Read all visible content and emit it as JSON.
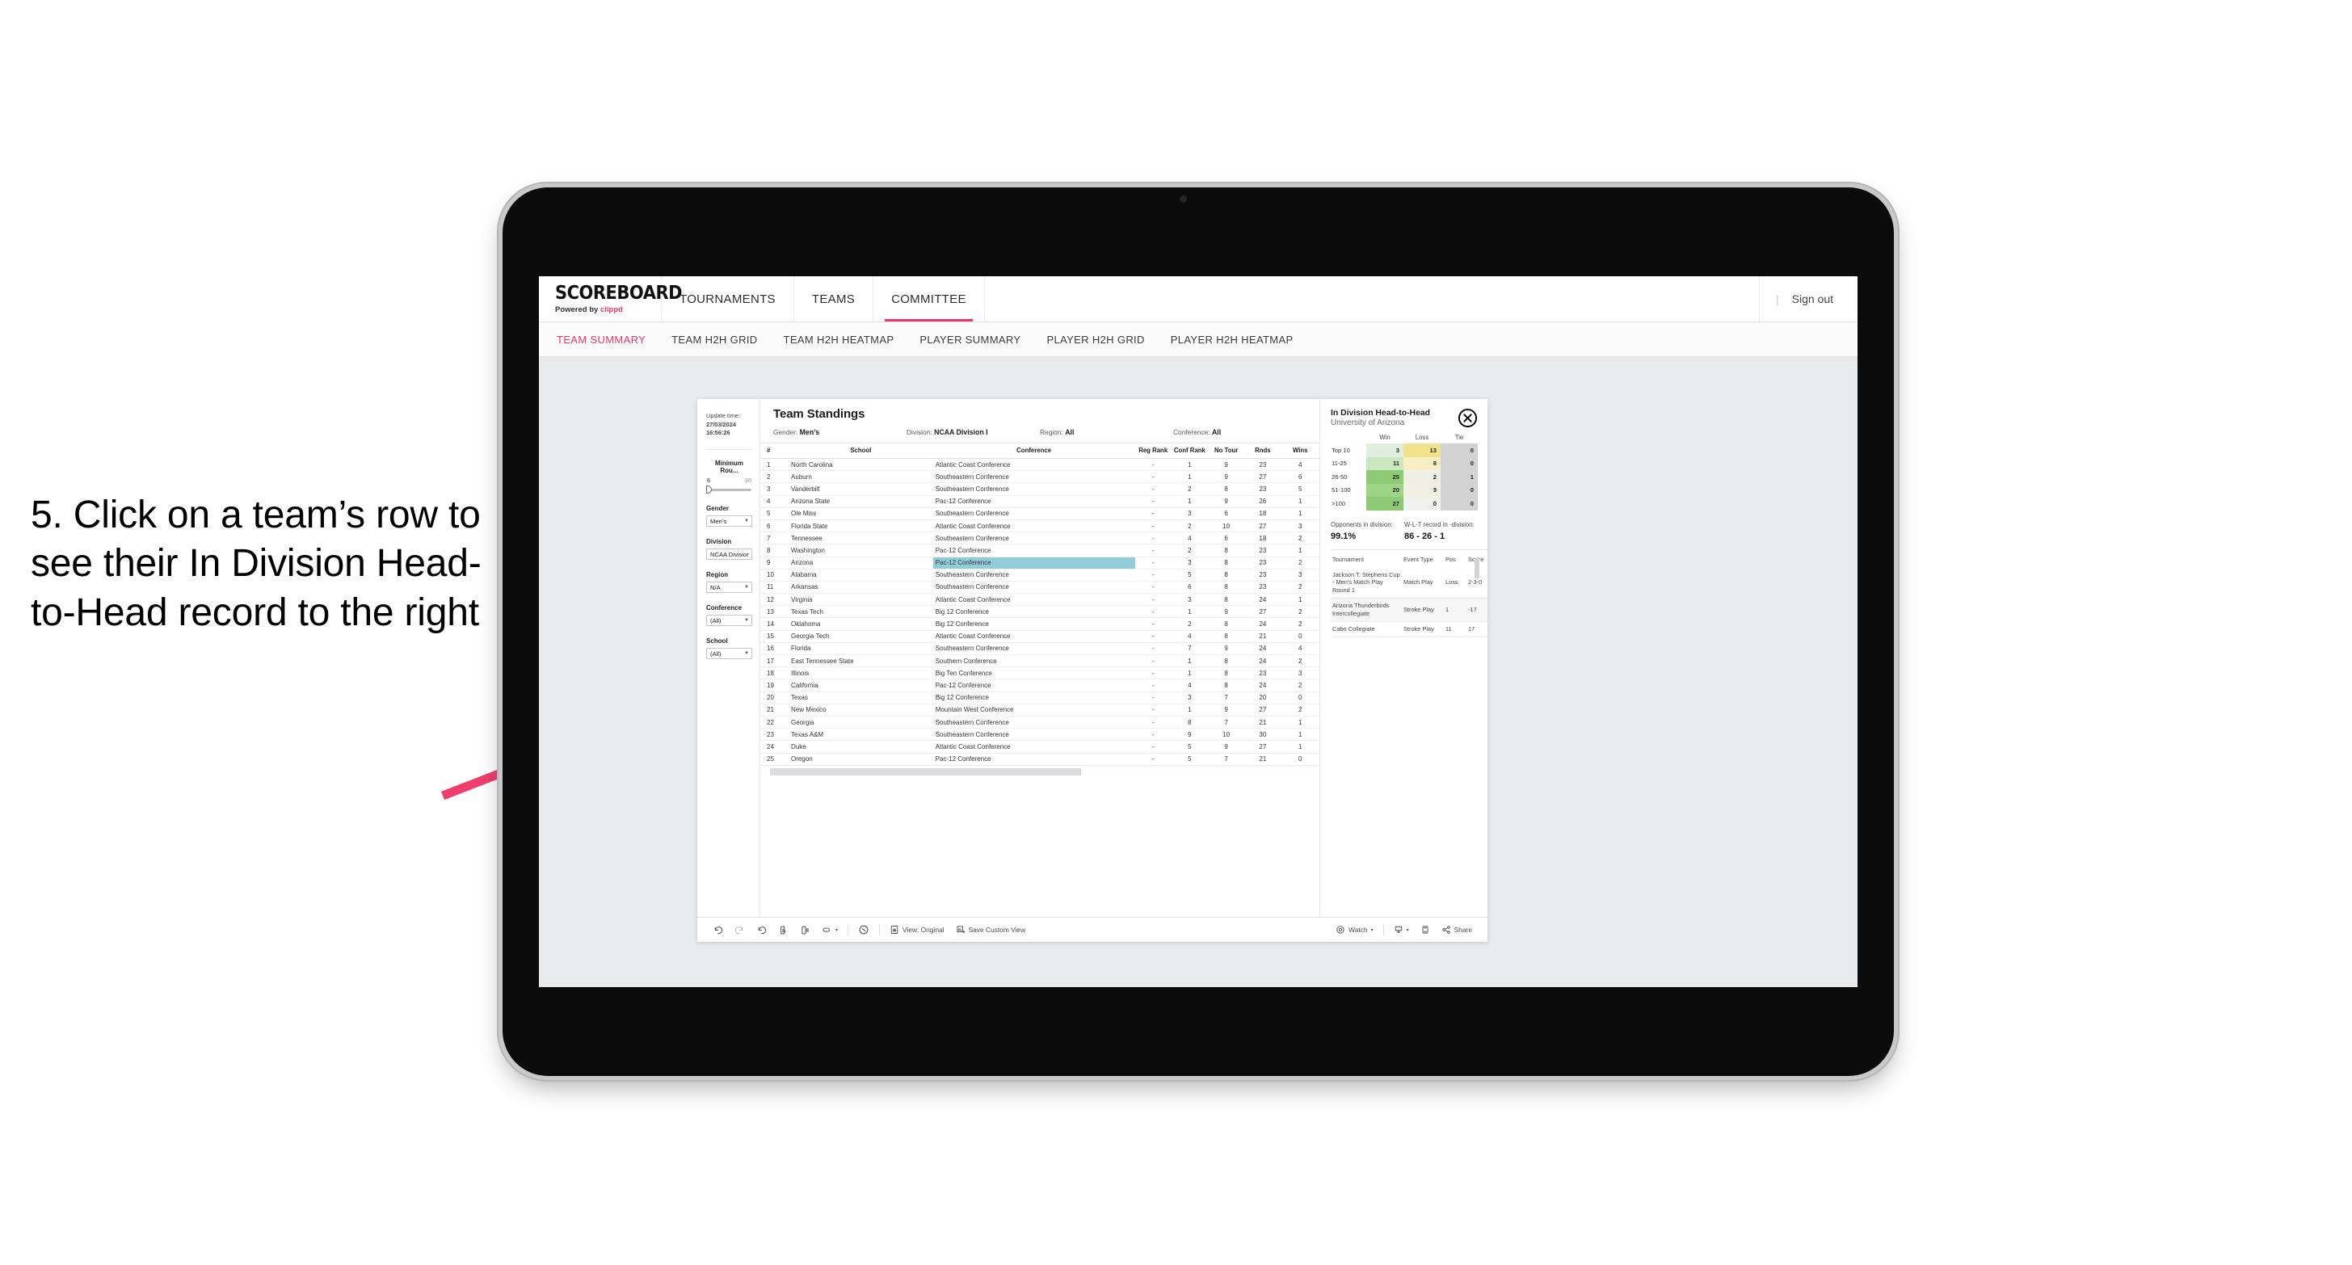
{
  "caption": "5. Click on a team’s row to see their In Division Head-to-Head record to the right",
  "colors": {
    "accent": "#e8386a",
    "highlight": "#92ccd9",
    "win": "#84c96b",
    "loss": "#f0dd8a",
    "tie": "#d0d0d0"
  },
  "topnav": {
    "logo": "SCOREBOARD",
    "powered_prefix": "Powered by ",
    "powered_brand": "clippd",
    "items": [
      {
        "label": "TOURNAMENTS",
        "active": false
      },
      {
        "label": "TEAMS",
        "active": false
      },
      {
        "label": "COMMITTEE",
        "active": true
      }
    ],
    "divider": "|",
    "sign_out": "Sign out"
  },
  "subtabs": [
    {
      "label": "TEAM SUMMARY",
      "active": true
    },
    {
      "label": "TEAM H2H GRID",
      "active": false
    },
    {
      "label": "TEAM H2H HEATMAP",
      "active": false
    },
    {
      "label": "PLAYER SUMMARY",
      "active": false
    },
    {
      "label": "PLAYER H2H GRID",
      "active": false
    },
    {
      "label": "PLAYER H2H HEATMAP",
      "active": false
    }
  ],
  "filters": {
    "update_time_label": "Update time:",
    "update_time_value": "27/03/2024 16:56:26",
    "min_rounds": {
      "label": "Minimum Rou...",
      "min": "6",
      "max": "30"
    },
    "groups": [
      {
        "label": "Gender",
        "value": "Men’s"
      },
      {
        "label": "Division",
        "value": "NCAA Division I"
      },
      {
        "label": "Region",
        "value": "N/A"
      },
      {
        "label": "Conference",
        "value": "(All)"
      },
      {
        "label": "School",
        "value": "(All)"
      }
    ]
  },
  "sheet": {
    "title": "Team Standings",
    "crumbs": [
      {
        "key": "Gender:",
        "value": "Men’s"
      },
      {
        "key": "Division:",
        "value": "NCAA Division I"
      },
      {
        "key": "Region:",
        "value": "All"
      },
      {
        "key": "Conference:",
        "value": "All"
      }
    ],
    "columns": [
      "#",
      "School",
      "Conference",
      "Reg Rank",
      "Conf Rank",
      "No Tour",
      "Rnds",
      "Wins"
    ],
    "highlight_row_index": 8,
    "rows": [
      [
        "1",
        "North Carolina",
        "Atlantic Coast Conference",
        "-",
        "1",
        "9",
        "23",
        "4"
      ],
      [
        "2",
        "Auburn",
        "Southeastern Conference",
        "-",
        "1",
        "9",
        "27",
        "6"
      ],
      [
        "3",
        "Vanderbilt",
        "Southeastern Conference",
        "-",
        "2",
        "8",
        "23",
        "5"
      ],
      [
        "4",
        "Arizona State",
        "Pac-12 Conference",
        "-",
        "1",
        "9",
        "26",
        "1"
      ],
      [
        "5",
        "Ole Miss",
        "Southeastern Conference",
        "-",
        "3",
        "6",
        "18",
        "1"
      ],
      [
        "6",
        "Florida State",
        "Atlantic Coast Conference",
        "-",
        "2",
        "10",
        "27",
        "3"
      ],
      [
        "7",
        "Tennessee",
        "Southeastern Conference",
        "-",
        "4",
        "6",
        "18",
        "2"
      ],
      [
        "8",
        "Washington",
        "Pac-12 Conference",
        "-",
        "2",
        "8",
        "23",
        "1"
      ],
      [
        "9",
        "Arizona",
        "Pac-12 Conference",
        "-",
        "3",
        "8",
        "23",
        "2"
      ],
      [
        "10",
        "Alabama",
        "Southeastern Conference",
        "-",
        "5",
        "8",
        "23",
        "3"
      ],
      [
        "11",
        "Arkansas",
        "Southeastern Conference",
        "-",
        "6",
        "8",
        "23",
        "2"
      ],
      [
        "12",
        "Virginia",
        "Atlantic Coast Conference",
        "-",
        "3",
        "8",
        "24",
        "1"
      ],
      [
        "13",
        "Texas Tech",
        "Big 12 Conference",
        "-",
        "1",
        "9",
        "27",
        "2"
      ],
      [
        "14",
        "Oklahoma",
        "Big 12 Conference",
        "-",
        "2",
        "8",
        "24",
        "2"
      ],
      [
        "15",
        "Georgia Tech",
        "Atlantic Coast Conference",
        "-",
        "4",
        "8",
        "21",
        "0"
      ],
      [
        "16",
        "Florida",
        "Southeastern Conference",
        "-",
        "7",
        "9",
        "24",
        "4"
      ],
      [
        "17",
        "East Tennessee State",
        "Southern Conference",
        "-",
        "1",
        "8",
        "24",
        "2"
      ],
      [
        "18",
        "Illinois",
        "Big Ten Conference",
        "-",
        "1",
        "8",
        "23",
        "3"
      ],
      [
        "19",
        "California",
        "Pac-12 Conference",
        "-",
        "4",
        "8",
        "24",
        "2"
      ],
      [
        "20",
        "Texas",
        "Big 12 Conference",
        "-",
        "3",
        "7",
        "20",
        "0"
      ],
      [
        "21",
        "New Mexico",
        "Mountain West Conference",
        "-",
        "1",
        "9",
        "27",
        "2"
      ],
      [
        "22",
        "Georgia",
        "Southeastern Conference",
        "-",
        "8",
        "7",
        "21",
        "1"
      ],
      [
        "23",
        "Texas A&M",
        "Southeastern Conference",
        "-",
        "9",
        "10",
        "30",
        "1"
      ],
      [
        "24",
        "Duke",
        "Atlantic Coast Conference",
        "-",
        "5",
        "9",
        "27",
        "1"
      ],
      [
        "25",
        "Oregon",
        "Pac-12 Conference",
        "-",
        "5",
        "7",
        "21",
        "0"
      ]
    ]
  },
  "h2h": {
    "title": "In Division Head-to-Head",
    "subtitle": "University of Arizona",
    "close_icon": "close-circle-icon",
    "matrix": {
      "columns": [
        "Win",
        "Loss",
        "Tie"
      ],
      "rows": [
        {
          "label": "Top 10",
          "win": "3",
          "loss": "13",
          "tie": "0",
          "win_bg": "#e0eee0",
          "loss_bg": "#f3e28c",
          "tie_bg": "#d2d2d2"
        },
        {
          "label": "11-25",
          "win": "11",
          "loss": "8",
          "tie": "0",
          "win_bg": "#cbe7bf",
          "loss_bg": "#f7eec4",
          "tie_bg": "#d2d2d2"
        },
        {
          "label": "26-50",
          "win": "25",
          "loss": "2",
          "tie": "1",
          "win_bg": "#8ccb73",
          "loss_bg": "#f0efe6",
          "tie_bg": "#d2d2d2"
        },
        {
          "label": "51-100",
          "win": "20",
          "loss": "3",
          "tie": "0",
          "win_bg": "#9ed486",
          "loss_bg": "#f2efe3",
          "tie_bg": "#d2d2d2"
        },
        {
          "label": ">100",
          "win": "27",
          "loss": "0",
          "tie": "0",
          "win_bg": "#8ccb73",
          "loss_bg": "#f1f1ee",
          "tie_bg": "#d2d2d2"
        }
      ]
    },
    "stats": [
      {
        "label": "Opponents in division:",
        "value": "99.1%"
      },
      {
        "label": "W-L-T record in -division:",
        "value": "86 - 26 - 1"
      }
    ],
    "tournaments": {
      "columns": [
        "Tournament",
        "Event Type",
        "Pos",
        "Score"
      ],
      "rows": [
        [
          "Jackson T. Stephens Cup - Men’s Match Play Round 1",
          "Match Play",
          "Loss",
          "2-3-0"
        ],
        [
          "Arizona Thunderbirds Intercollegiate",
          "Stroke Play",
          "1",
          "-17"
        ],
        [
          "Cabo Collegiate",
          "Stroke Play",
          "11",
          "17"
        ]
      ]
    }
  },
  "toolbar": {
    "undo": "undo-icon",
    "redo": "redo-icon",
    "revert": "revert-icon",
    "refresh": "refresh-data-icon",
    "pause": "pause-updates-icon",
    "highlight": "highlight-icon",
    "highlight_caret": "▾",
    "help": "help-icon",
    "view_label": "View: Original",
    "save_label": "Save Custom View",
    "watch_label": "Watch",
    "watch_caret": "▾",
    "download_caret": "▾",
    "share_label": "Share"
  }
}
